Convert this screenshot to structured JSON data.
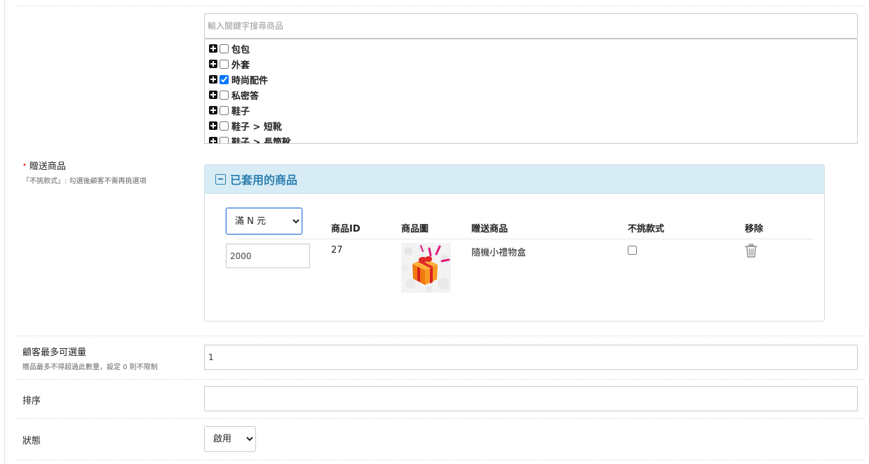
{
  "product_search": {
    "placeholder": "輸入關鍵字搜尋商品"
  },
  "category_tree": [
    {
      "label": "包包",
      "checked": false
    },
    {
      "label": "外套",
      "checked": false
    },
    {
      "label": "時尚配件",
      "checked": true
    },
    {
      "label": "私密答",
      "checked": false
    },
    {
      "label": "鞋子",
      "checked": false
    },
    {
      "label": "鞋子 > 短靴",
      "checked": false
    },
    {
      "label": "鞋子 > 長筒靴",
      "checked": false
    }
  ],
  "gift_products": {
    "label": "贈送商品",
    "required_mark": "•",
    "hint": "「不挑款式」: 勾選後顧客不需再挑選項"
  },
  "applied_panel": {
    "title": "已套用的商品",
    "condition_select": {
      "selected": "滿 N 元",
      "options": [
        "滿 N 元"
      ]
    },
    "columns": {
      "product_id": "商品ID",
      "product_image": "商品圖",
      "gift_product": "贈送商品",
      "no_style_choice": "不挑款式",
      "remove": "移除"
    },
    "rows": [
      {
        "amount": "2000",
        "product_id": "27",
        "gift_name": "隨機小禮物盒",
        "no_style_choice": false
      }
    ]
  },
  "max_qty": {
    "label": "顧客最多可選量",
    "hint": "贈品最多不得超過此數量，設定 0 則不限制",
    "value": "1"
  },
  "sort": {
    "label": "排序",
    "value": ""
  },
  "status": {
    "label": "狀態",
    "selected": "啟用",
    "options": [
      "啟用"
    ]
  },
  "colors": {
    "accent": "#2e7fb0",
    "panel_header": "#d8ecf6",
    "required": "#e02020"
  }
}
